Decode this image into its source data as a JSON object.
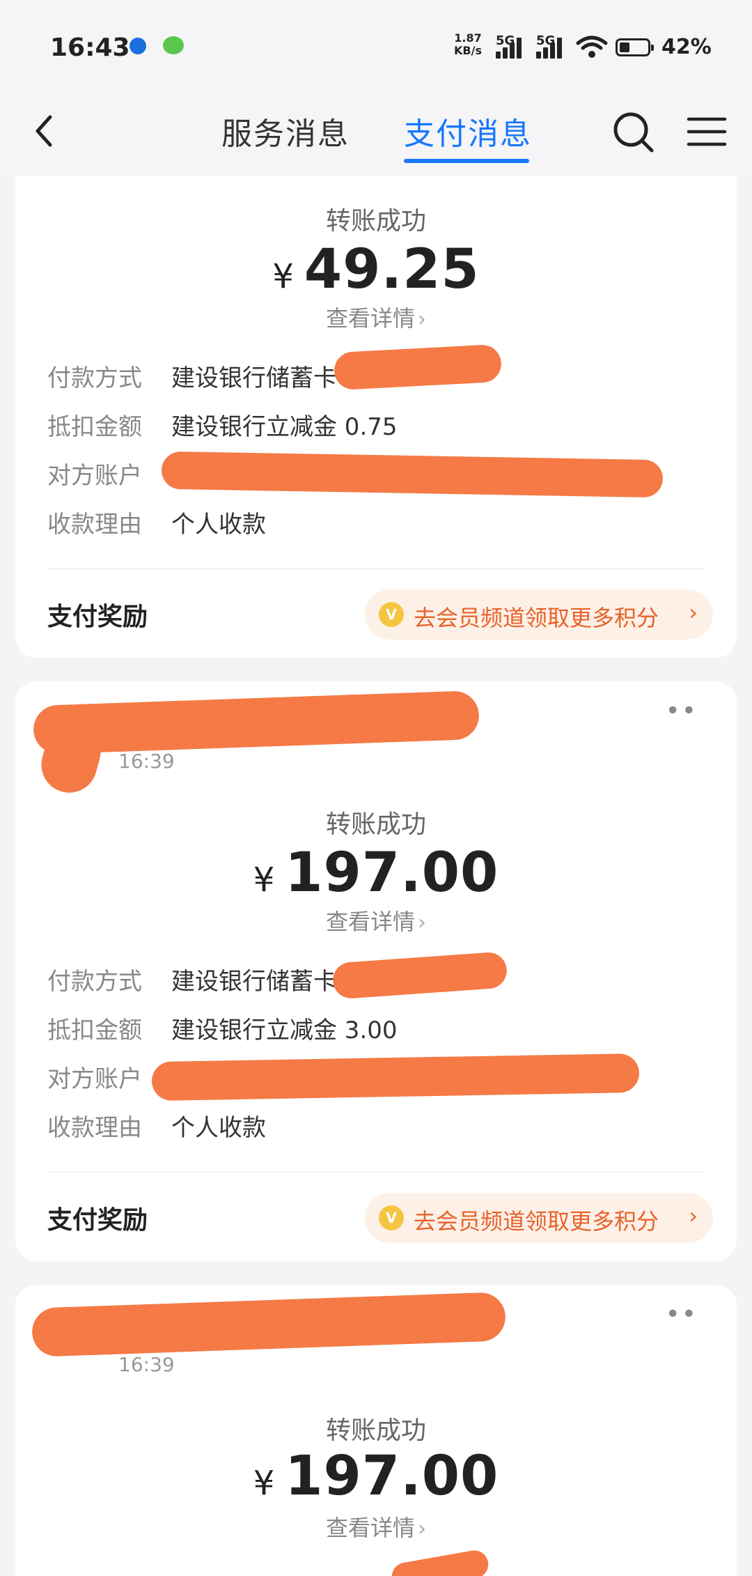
{
  "status_bar": {
    "time": "16:43",
    "net_speed": "1.87\nKB/s",
    "signal1": "5G",
    "signal2": "5G",
    "battery": "42%"
  },
  "nav": {
    "tabs": [
      {
        "label": "服务消息",
        "active": false
      },
      {
        "label": "支付消息",
        "active": true
      }
    ],
    "accent": "#1677ff"
  },
  "cards": [
    {
      "status": "转账成功",
      "currency": "¥",
      "amount": "49.25",
      "detail": "查看详情",
      "rows": [
        {
          "label": "付款方式",
          "value": "建设银行储蓄卡"
        },
        {
          "label": "抵扣金额",
          "value": "建设银行立减金 0.75"
        },
        {
          "label": "对方账户",
          "value": ""
        },
        {
          "label": "收款理由",
          "value": "个人收款"
        }
      ],
      "reward_title": "支付奖励",
      "reward_link": "去会员频道领取更多积分"
    },
    {
      "time": "16:39",
      "status": "转账成功",
      "currency": "¥",
      "amount": "197.00",
      "detail": "查看详情",
      "rows": [
        {
          "label": "付款方式",
          "value": "建设银行储蓄卡"
        },
        {
          "label": "抵扣金额",
          "value": "建设银行立减金 3.00"
        },
        {
          "label": "对方账户",
          "value": ""
        },
        {
          "label": "收款理由",
          "value": "个人收款"
        }
      ],
      "reward_title": "支付奖励",
      "reward_link": "去会员频道领取更多积分"
    },
    {
      "time": "16:39",
      "status": "转账成功",
      "currency": "¥",
      "amount": "197.00",
      "detail": "查看详情"
    }
  ],
  "colors": {
    "redaction": "#f57a46",
    "reward": "#e8622a",
    "coin": "#f5c542"
  }
}
